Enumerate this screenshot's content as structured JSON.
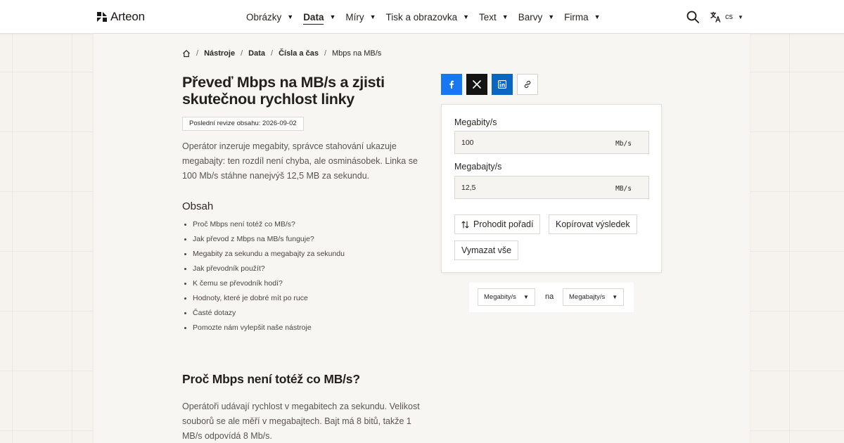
{
  "brand": {
    "name": "Arteon"
  },
  "nav": {
    "items": [
      {
        "label": "Obrázky"
      },
      {
        "label": "Data"
      },
      {
        "label": "Míry"
      },
      {
        "label": "Tisk a obrazovka"
      },
      {
        "label": "Text"
      },
      {
        "label": "Barvy"
      },
      {
        "label": "Firma"
      }
    ],
    "active": "Data"
  },
  "language": {
    "code": "cs"
  },
  "breadcrumb": {
    "items": [
      "Nástroje",
      "Data",
      "Čísla a čas"
    ],
    "current": "Mbps na MB/s"
  },
  "article": {
    "title": "Převeď Mbps na MB/s a zjisti skutečnou rychlost linky",
    "revision": "Poslední revize obsahu: 2026-09-02",
    "intro": "Operátor inzeruje megabity, správce stahování ukazuje megabajty: ten rozdíl není chyba, ale osminásobek. Linka se 100 Mb/s stáhne nanejvýš 12,5 MB za sekundu.",
    "toc_title": "Obsah",
    "toc": [
      "Proč Mbps není totéž co MB/s?",
      "Jak převod z Mbps na MB/s funguje?",
      "Megabity za sekundu a megabajty za sekundu",
      "Jak převodník použít?",
      "K čemu se převodník hodí?",
      "Hodnoty, které je dobré mít po ruce",
      "Časté dotazy",
      "Pomozte nám vylepšit naše nástroje"
    ],
    "section_title": "Proč Mbps není totéž co MB/s?",
    "section_text": "Operátoři udávají rychlost v megabitech za sekundu. Velikost souborů se ale měří v megabajtech. Bajt má 8 bitů, takže 1 MB/s odpovídá 8 Mb/s."
  },
  "share": {
    "icons": [
      "facebook-icon",
      "x-icon",
      "linkedin-icon",
      "link-icon"
    ],
    "colors": {
      "facebook": "#1877f2",
      "x": "#141414",
      "linkedin": "#0a66c2"
    }
  },
  "converter": {
    "from": {
      "label": "Megabity/s",
      "value": "100",
      "unit": "Mb/s"
    },
    "to": {
      "label": "Megabajty/s",
      "value": "12,5",
      "unit": "MB/s"
    },
    "buttons": {
      "swap": "Prohodit pořadí",
      "copy": "Kopírovat výsledek",
      "clear": "Vymazat vše"
    },
    "unit_select": {
      "from": "Megabity/s",
      "connector": "na",
      "to": "Megabajty/s"
    }
  }
}
